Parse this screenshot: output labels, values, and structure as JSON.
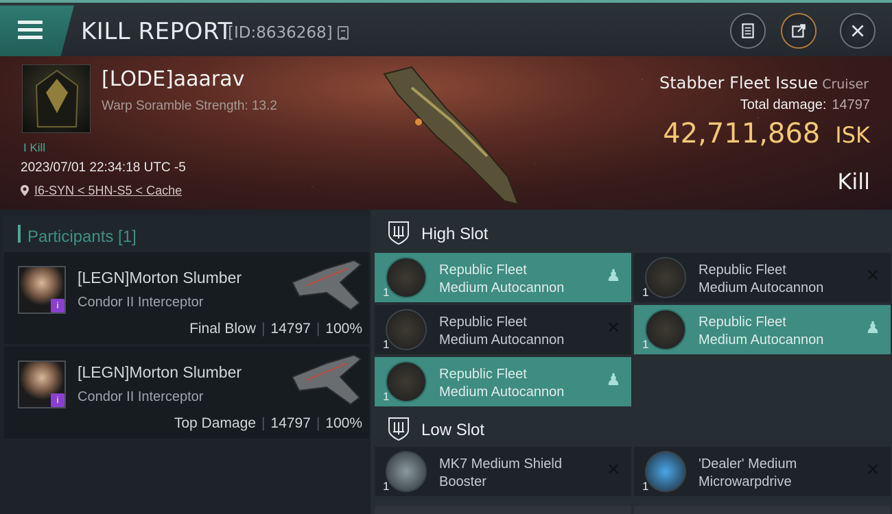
{
  "header": {
    "title": "KILL REPORT",
    "id_text": "[ID:8636268]",
    "icons": {
      "menu": "menu-icon",
      "copy": "copy-icon",
      "clipboard": "clipboard-icon",
      "share": "share-icon",
      "close": "close-icon"
    }
  },
  "victim": {
    "name": "[LODE]aaarav",
    "warp_scramble": "Warp Soramble Strength: 13.2",
    "kill_tag": "I Kill",
    "datetime": "2023/07/01 22:34:18 UTC -5",
    "location": "I6-SYN < 5HN-S5 < Cache",
    "ship_name": "Stabber Fleet Issue",
    "ship_class": "Cruiser",
    "total_damage_label": "Total damage:",
    "total_damage_value": "14797",
    "isk_value": "42,711,868",
    "isk_unit": "ISK",
    "result": "Kill"
  },
  "participants": {
    "title": "Participants [1]",
    "items": [
      {
        "name": "[LEGN]Morton Slumber",
        "ship": "Condor II Interceptor",
        "role": "Final Blow",
        "damage": "14797",
        "percent": "100%",
        "badge": "i"
      },
      {
        "name": "[LEGN]Morton Slumber",
        "ship": "Condor II Interceptor",
        "role": "Top Damage",
        "damage": "14797",
        "percent": "100%",
        "badge": "i"
      }
    ]
  },
  "slots": {
    "high": {
      "label": "High Slot",
      "modules": [
        {
          "line1": "Republic Fleet",
          "line2": "Medium Autocannon",
          "qty": "1",
          "state": "fitted",
          "status_icon": "person-icon"
        },
        {
          "line1": "Republic Fleet",
          "line2": "Medium Autocannon",
          "qty": "1",
          "state": "destroyed",
          "status_icon": "x-icon"
        },
        {
          "line1": "Republic Fleet",
          "line2": "Medium Autocannon",
          "qty": "1",
          "state": "destroyed",
          "status_icon": "x-icon"
        },
        {
          "line1": "Republic Fleet",
          "line2": "Medium Autocannon",
          "qty": "1",
          "state": "fitted",
          "status_icon": "person-icon"
        },
        {
          "line1": "Republic Fleet",
          "line2": "Medium Autocannon",
          "qty": "1",
          "state": "fitted",
          "status_icon": "person-icon"
        }
      ]
    },
    "low": {
      "label": "Low Slot",
      "modules": [
        {
          "line1": "MK7 Medium Shield",
          "line2": "Booster",
          "qty": "1",
          "state": "destroyed",
          "status_icon": "x-icon"
        },
        {
          "line1": "'Dealer' Medium",
          "line2": "Microwarpdrive",
          "qty": "1",
          "state": "destroyed",
          "status_icon": "x-icon"
        }
      ]
    }
  },
  "colors": {
    "accent": "#3e8c82",
    "isk": "#f4c876",
    "badge": "#8b3fd0"
  }
}
